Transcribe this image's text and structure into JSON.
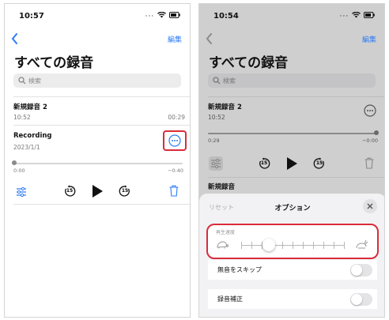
{
  "left_screen": {
    "status": {
      "time": "10:57"
    },
    "nav": {
      "edit_label": "編集"
    },
    "title": "すべての録音",
    "search": {
      "placeholder": "検索"
    },
    "recordings": [
      {
        "title": "新規録音 2",
        "date": "10:52",
        "duration": "00:29"
      },
      {
        "title": "Recording",
        "date": "2023/1/1"
      }
    ],
    "player": {
      "elapsed": "0:00",
      "remaining": "−0:40",
      "skip_seconds": "15"
    }
  },
  "right_screen": {
    "status": {
      "time": "10:54"
    },
    "nav": {
      "edit_label": "編集"
    },
    "title": "すべての録音",
    "search": {
      "placeholder": "検索"
    },
    "recordings": [
      {
        "title": "新規録音 2",
        "date": "10:52"
      },
      {
        "title": "新規録音"
      }
    ],
    "player": {
      "elapsed": "0:29",
      "remaining": "−0:00",
      "skip_seconds": "15"
    },
    "options": {
      "reset_label": "リセット",
      "title": "オプション",
      "playback_speed_label": "再生速度",
      "playback_speed_position": 0.27,
      "skip_silence_label": "無音をスキップ",
      "enhance_label": "録音補正"
    }
  },
  "colors": {
    "accent": "#2f7cf6",
    "highlight": "#d92c3c"
  }
}
